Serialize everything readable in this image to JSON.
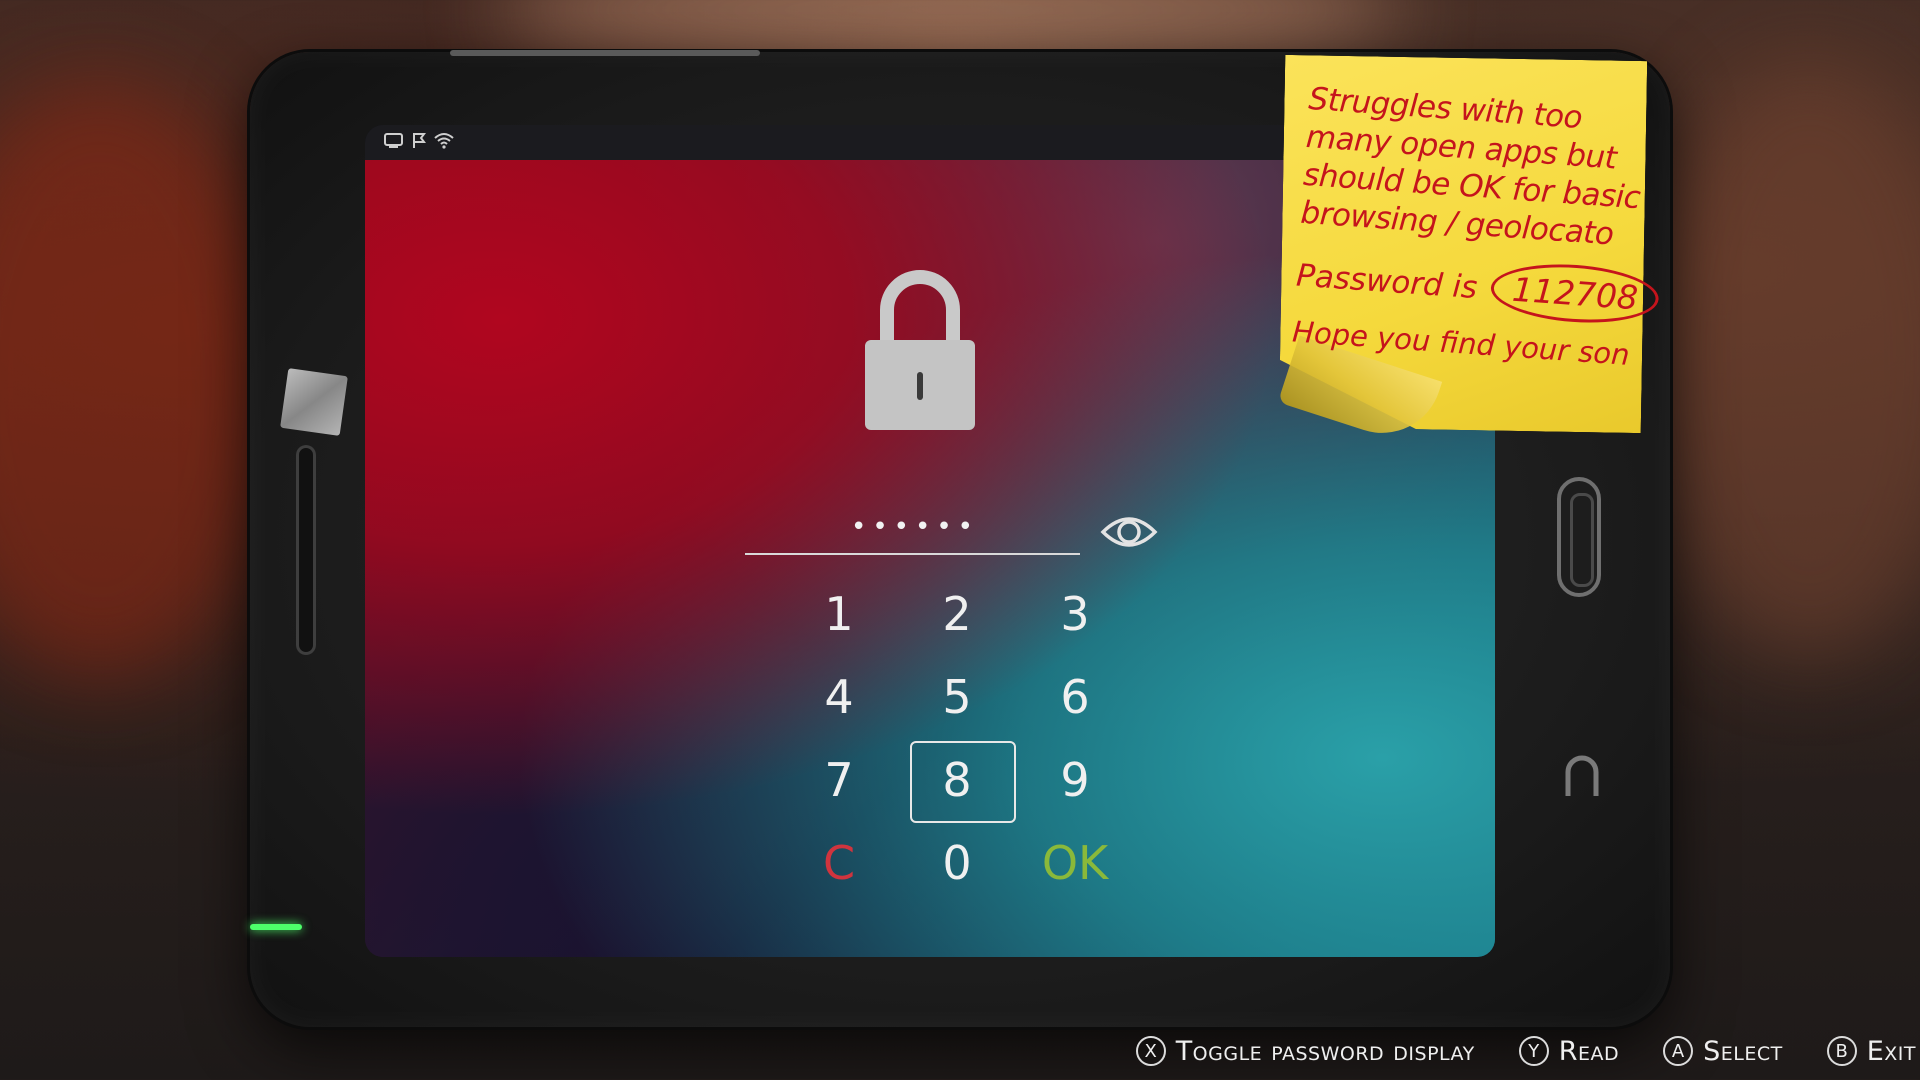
{
  "status_bar": {
    "icons": [
      "tablet-icon",
      "flag-icon",
      "wifi-icon"
    ]
  },
  "lock_screen": {
    "password_mask": "••••••",
    "password_length": 6,
    "keypad": {
      "keys": [
        "1",
        "2",
        "3",
        "4",
        "5",
        "6",
        "7",
        "8",
        "9",
        "C",
        "0",
        "OK"
      ],
      "selected": "8"
    },
    "colors": {
      "clear": "#d0343e",
      "ok": "#8ab93a"
    }
  },
  "sticky_note": {
    "lines": [
      "Struggles with too",
      "many open apps but",
      "should be OK for basic",
      "browsing / geolocato"
    ],
    "password_label": "Password is",
    "password_value": "112708",
    "closing": "Hope you find your son",
    "color": "#f5d93c",
    "ink": "#c5141c"
  },
  "prompts": [
    {
      "button": "X",
      "label": "Toggle password display"
    },
    {
      "button": "Y",
      "label": "Read"
    },
    {
      "button": "A",
      "label": "Select"
    },
    {
      "button": "B",
      "label": "Exit"
    }
  ]
}
